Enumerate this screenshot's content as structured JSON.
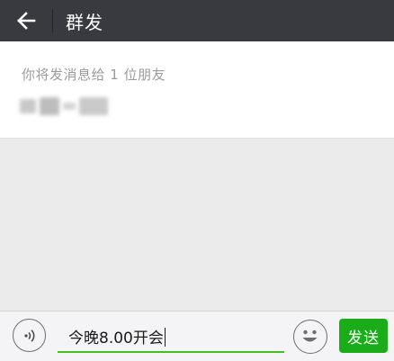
{
  "header": {
    "title": "群发",
    "back_icon": "arrow-left-icon"
  },
  "recipients": {
    "hint": "你将发消息给 1 位朋友"
  },
  "composer": {
    "input_value": "今晚8.00开会",
    "voice_icon": "voice-icon",
    "emoji_icon": "emoji-icon",
    "send_label": "发送"
  },
  "colors": {
    "topbar": "#393a3f",
    "send_button": "#1aad19",
    "input_underline": "#45c01a",
    "background": "#ebebeb"
  }
}
